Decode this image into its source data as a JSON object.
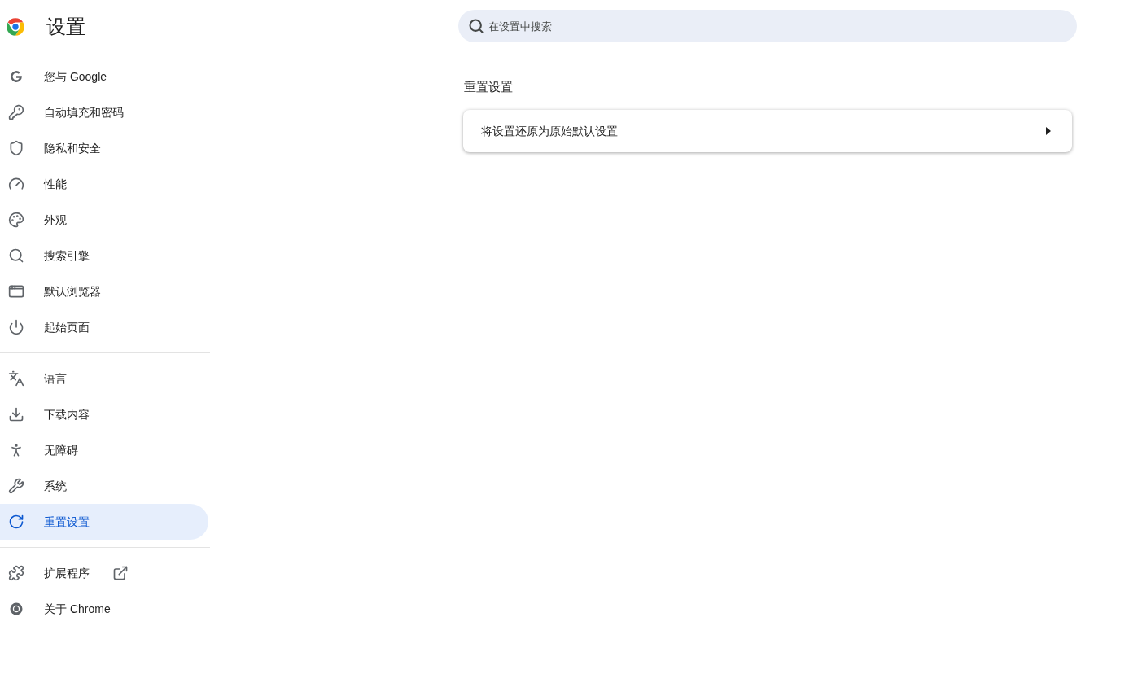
{
  "header": {
    "title": "设置"
  },
  "search": {
    "placeholder": "在设置中搜索"
  },
  "sidebar": {
    "groups": [
      {
        "items": [
          {
            "label": "您与 Google",
            "selected": false
          },
          {
            "label": "自动填充和密码",
            "selected": false
          },
          {
            "label": "隐私和安全",
            "selected": false
          },
          {
            "label": "性能",
            "selected": false
          },
          {
            "label": "外观",
            "selected": false
          },
          {
            "label": "搜索引擎",
            "selected": false
          },
          {
            "label": "默认浏览器",
            "selected": false
          },
          {
            "label": "起始页面",
            "selected": false
          }
        ]
      },
      {
        "items": [
          {
            "label": "语言",
            "selected": false
          },
          {
            "label": "下载内容",
            "selected": false
          },
          {
            "label": "无障碍",
            "selected": false
          },
          {
            "label": "系统",
            "selected": false
          },
          {
            "label": "重置设置",
            "selected": true
          }
        ]
      },
      {
        "items": [
          {
            "label": "扩展程序",
            "selected": false,
            "external": true
          },
          {
            "label": "关于 Chrome",
            "selected": false,
            "external": false
          }
        ]
      }
    ]
  },
  "section": {
    "title": "重置设置",
    "rows": [
      {
        "label": "将设置还原为原始默认设置"
      }
    ]
  }
}
